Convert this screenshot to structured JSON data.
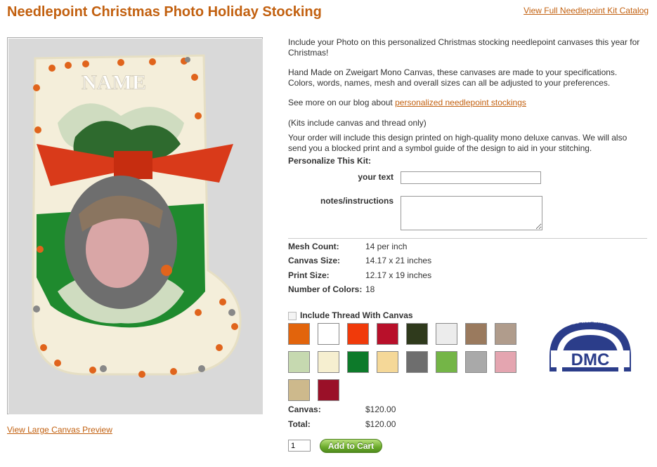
{
  "page": {
    "title": "Needlepoint Christmas Photo Holiday Stocking",
    "catalog_link": "View Full Needlepoint Kit Catalog",
    "large_preview_link": "View Large Canvas Preview"
  },
  "preview": {
    "name_text": "NAME"
  },
  "description": {
    "intro": "Include your Photo on this personalized Christmas stocking needlepoint canvases this year for Christmas!",
    "handmade": "Hand Made on Zweigart Mono Canvas, these canvases are made to your specifications. Colors, words, names, mesh and overall sizes can all be adjusted to your preferences.",
    "blog_prefix": "See more on our blog about ",
    "blog_link": "personalized needlepoint stockings",
    "kits_note": "(Kits include canvas and thread only)",
    "order_note": "Your order will include this design printed on high-quality mono deluxe canvas. We will also send you a blocked print and a symbol guide of the design to aid in your stitching."
  },
  "personalize": {
    "heading": "Personalize This Kit:",
    "your_text_label": "your text",
    "your_text_value": "",
    "notes_label": "notes/instructions",
    "notes_value": ""
  },
  "specs": {
    "mesh_label": "Mesh Count:",
    "mesh_value": "14 per inch",
    "canvas_label": "Canvas Size:",
    "canvas_value": "14.17 x 21 inches",
    "print_label": "Print Size:",
    "print_value": "12.17 x 19 inches",
    "colors_label": "Number of Colors:",
    "colors_value": "18"
  },
  "thread": {
    "label": "Include Thread With Canvas",
    "checked": false,
    "swatches": [
      "#e2640c",
      "#ffffff",
      "#f03a0a",
      "#b8102a",
      "#2f3a1c",
      "#ececec",
      "#9a7a5e",
      "#b09c8c",
      "#c6d9b0",
      "#f6efd0",
      "#0d7a2a",
      "#f5d898",
      "#6e6e6e",
      "#74b547",
      "#a9a9a9",
      "#e4a5b0",
      "#cdb98c",
      "#9a1028"
    ]
  },
  "dmc_logo": {
    "arc_text": "CREATIVE WORLD",
    "brand": "DMC"
  },
  "totals": {
    "canvas_label": "Canvas:",
    "canvas_value": "$120.00",
    "total_label": "Total:",
    "total_value": "$120.00"
  },
  "cart": {
    "quantity": "1",
    "button_label": "Add to Cart"
  },
  "colors": {
    "title": "#c2600f",
    "link": "#c2600f",
    "button": "#6cab2c"
  }
}
